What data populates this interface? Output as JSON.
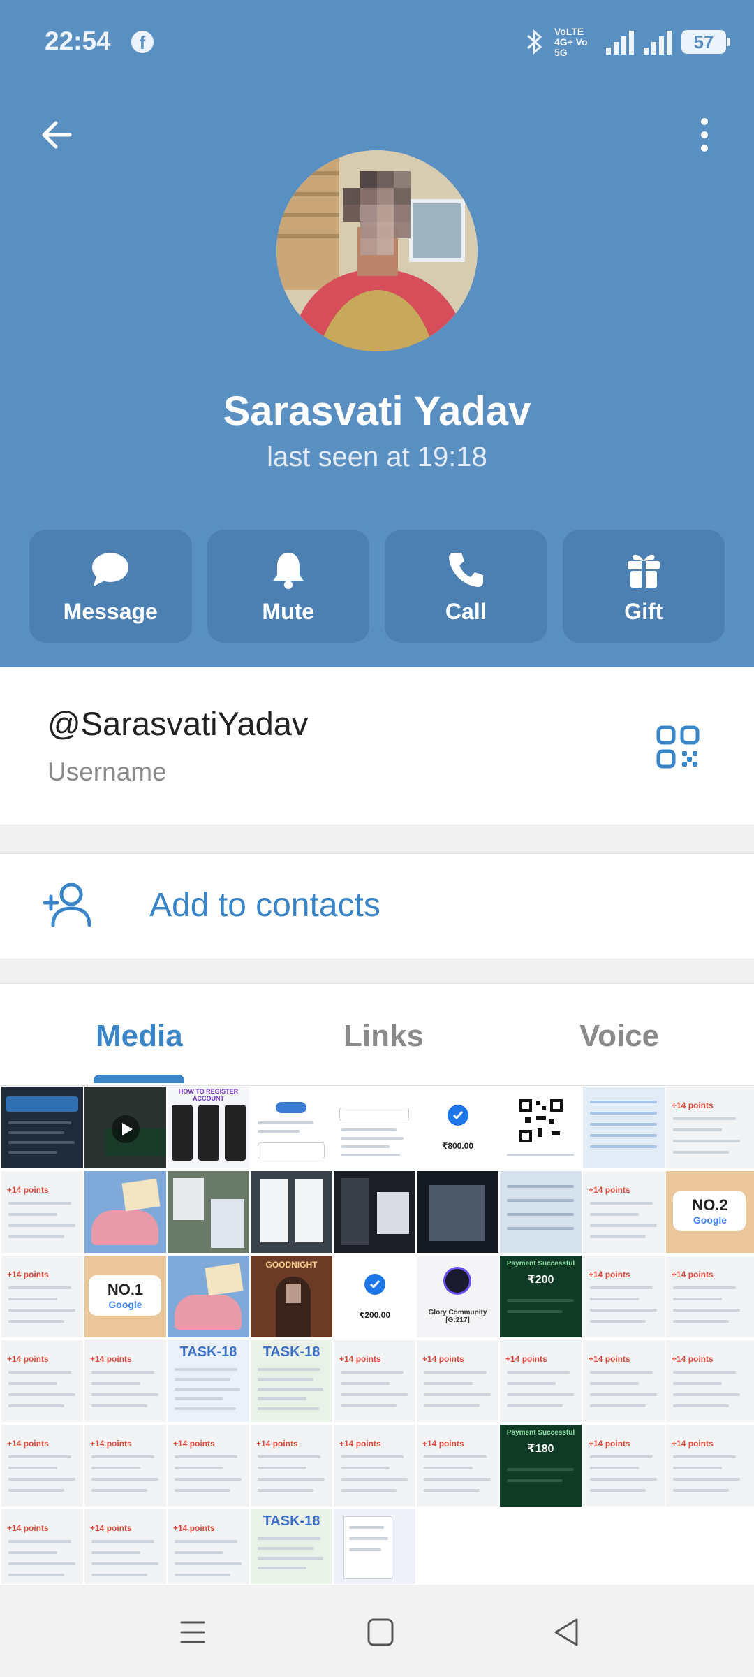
{
  "status_bar": {
    "time": "22:54",
    "network": "VoLTE 4G+ Vo 5G",
    "battery": "57"
  },
  "profile": {
    "name": "Sarasvati Yadav",
    "last_seen": "last seen at 19:18"
  },
  "actions": [
    {
      "label": "Message",
      "icon": "message-icon"
    },
    {
      "label": "Mute",
      "icon": "bell-icon"
    },
    {
      "label": "Call",
      "icon": "phone-icon"
    },
    {
      "label": "Gift",
      "icon": "gift-icon"
    }
  ],
  "username": {
    "value": "@SarasvatiYadav",
    "label": "Username"
  },
  "add_contact": {
    "label": "Add to contacts"
  },
  "tabs": [
    {
      "label": "Media",
      "active": true
    },
    {
      "label": "Links",
      "active": false
    },
    {
      "label": "Voice",
      "active": false
    }
  ],
  "media_texts": {
    "points": "+14 points",
    "amount_800": "₹800.00",
    "amount_200": "₹200.00",
    "amount_200b": "₹200",
    "amount_180": "₹180",
    "no1": "NO.1",
    "no2": "NO.2",
    "google": "Google",
    "task18": "TASK-18",
    "goodnight": "GOODNIGHT",
    "community": "Glory Community [G:217]",
    "register": "HOW TO REGISTER ACCOUNT",
    "payment": "Payment Successful"
  },
  "colors": {
    "header": "#5a8fc2",
    "accent": "#3a84c8"
  }
}
